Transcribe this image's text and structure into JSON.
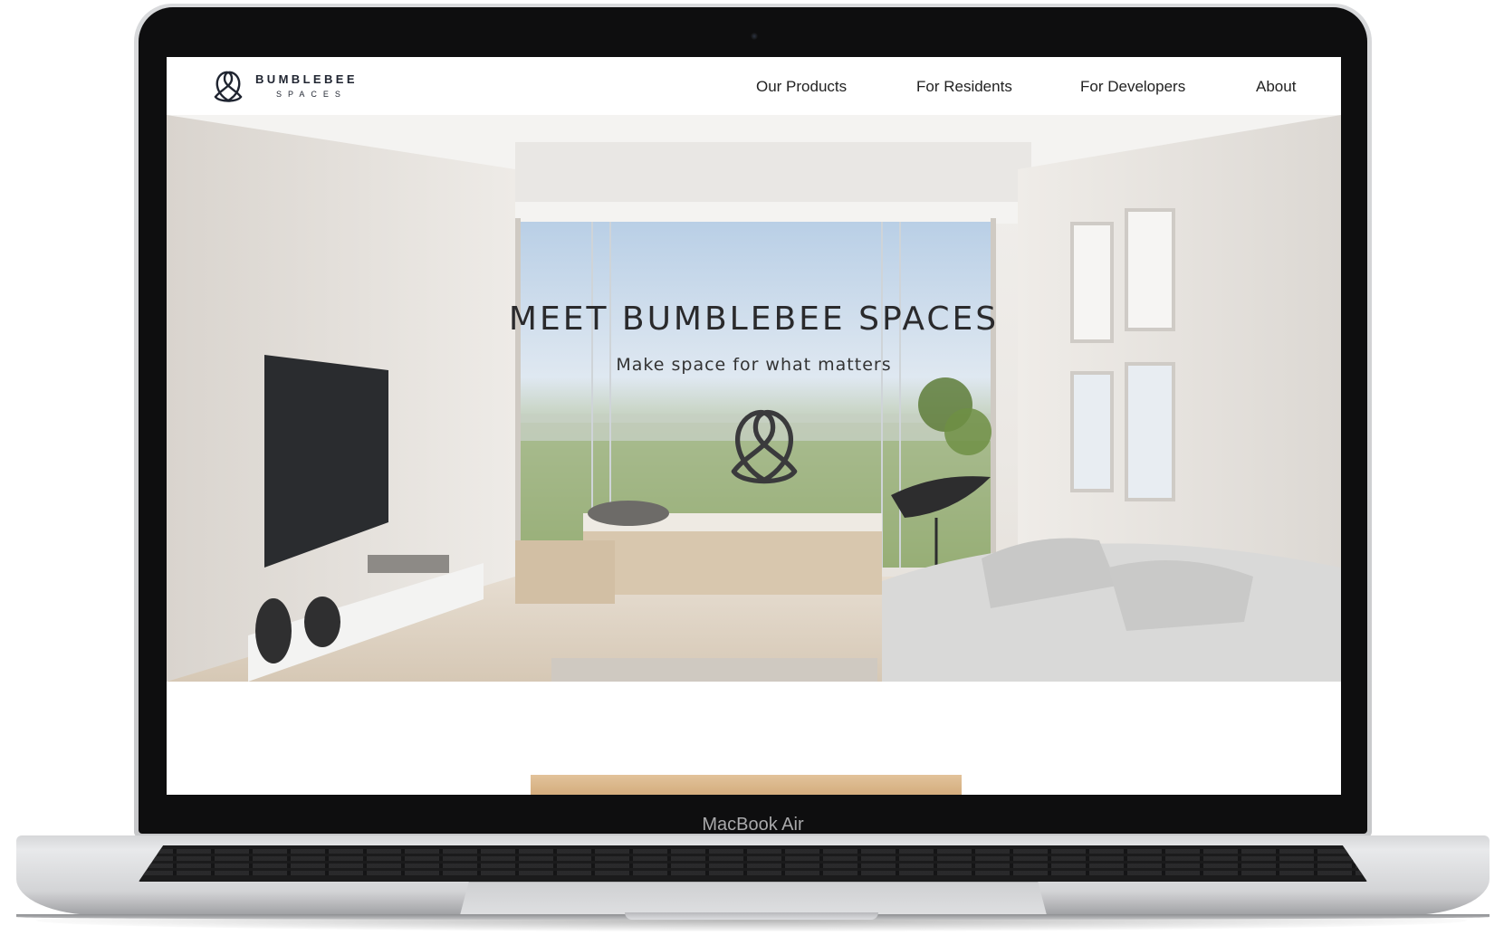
{
  "device": {
    "model_label": "MacBook Air"
  },
  "site": {
    "brand_name": "BUMBLEBEE",
    "brand_sub": "SPACES",
    "nav": [
      {
        "label": "Our Products"
      },
      {
        "label": "For Residents"
      },
      {
        "label": "For Developers"
      },
      {
        "label": "About"
      }
    ],
    "hero": {
      "title": "MEET BUMBLEBEE SPACES",
      "subtitle": "Make space for what matters"
    }
  },
  "colors": {
    "brand_text": "#1f2430",
    "hero_text": "#2a2a2c",
    "bezel": "#0e0e0f",
    "wood_accent": "#d9b487"
  },
  "icons": {
    "logo": "bumblebee-logo-icon"
  }
}
